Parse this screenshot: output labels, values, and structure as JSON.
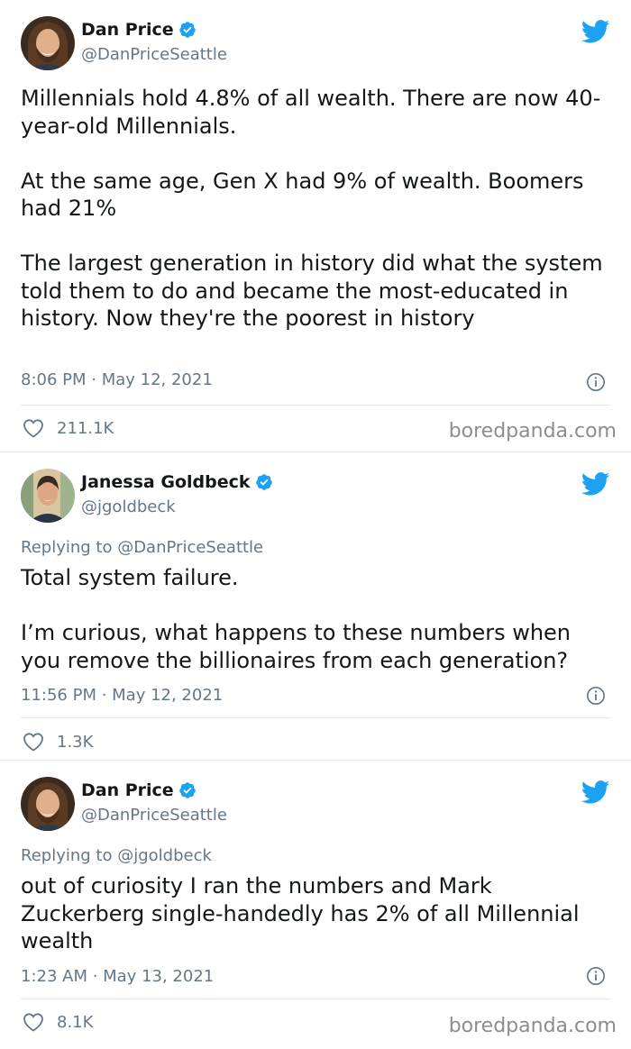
{
  "tweets": [
    {
      "name": "Dan Price",
      "handle": "@DanPriceSeattle",
      "reply_to": "",
      "text": "Millennials hold 4.8% of all wealth. There are now 40-year-old Millennials.\n\nAt the same age, Gen X had 9% of wealth. Boomers had 21%\n\nThe largest generation in history did what the system told them to do and became the most-educated in history. Now they're the poorest in history",
      "time": "8:06 PM · May 12, 2021",
      "likes": "211.1K",
      "avatar": "bearded-man-avatar"
    },
    {
      "name": "Janessa Goldbeck",
      "handle": "@jgoldbeck",
      "reply_to": "Replying to @DanPriceSeattle",
      "text": "Total system failure.\n\nI’m curious, what happens to these numbers when you remove the billionaires from each generation?",
      "time": "11:56 PM · May 12, 2021",
      "likes": "1.3K",
      "avatar": "woman-avatar"
    },
    {
      "name": "Dan Price",
      "handle": "@DanPriceSeattle",
      "reply_to": "Replying to @jgoldbeck",
      "text": "out of curiosity I ran the numbers and Mark Zuckerberg single-handedly has 2% of all Millennial wealth",
      "time": "1:23 AM · May 13, 2021",
      "likes": "8.1K",
      "avatar": "bearded-man-avatar"
    }
  ],
  "watermark": "boredpanda.com",
  "colors": {
    "twitter_blue": "#1da1f2",
    "muted": "#657786",
    "divider": "#e1e8ed"
  }
}
